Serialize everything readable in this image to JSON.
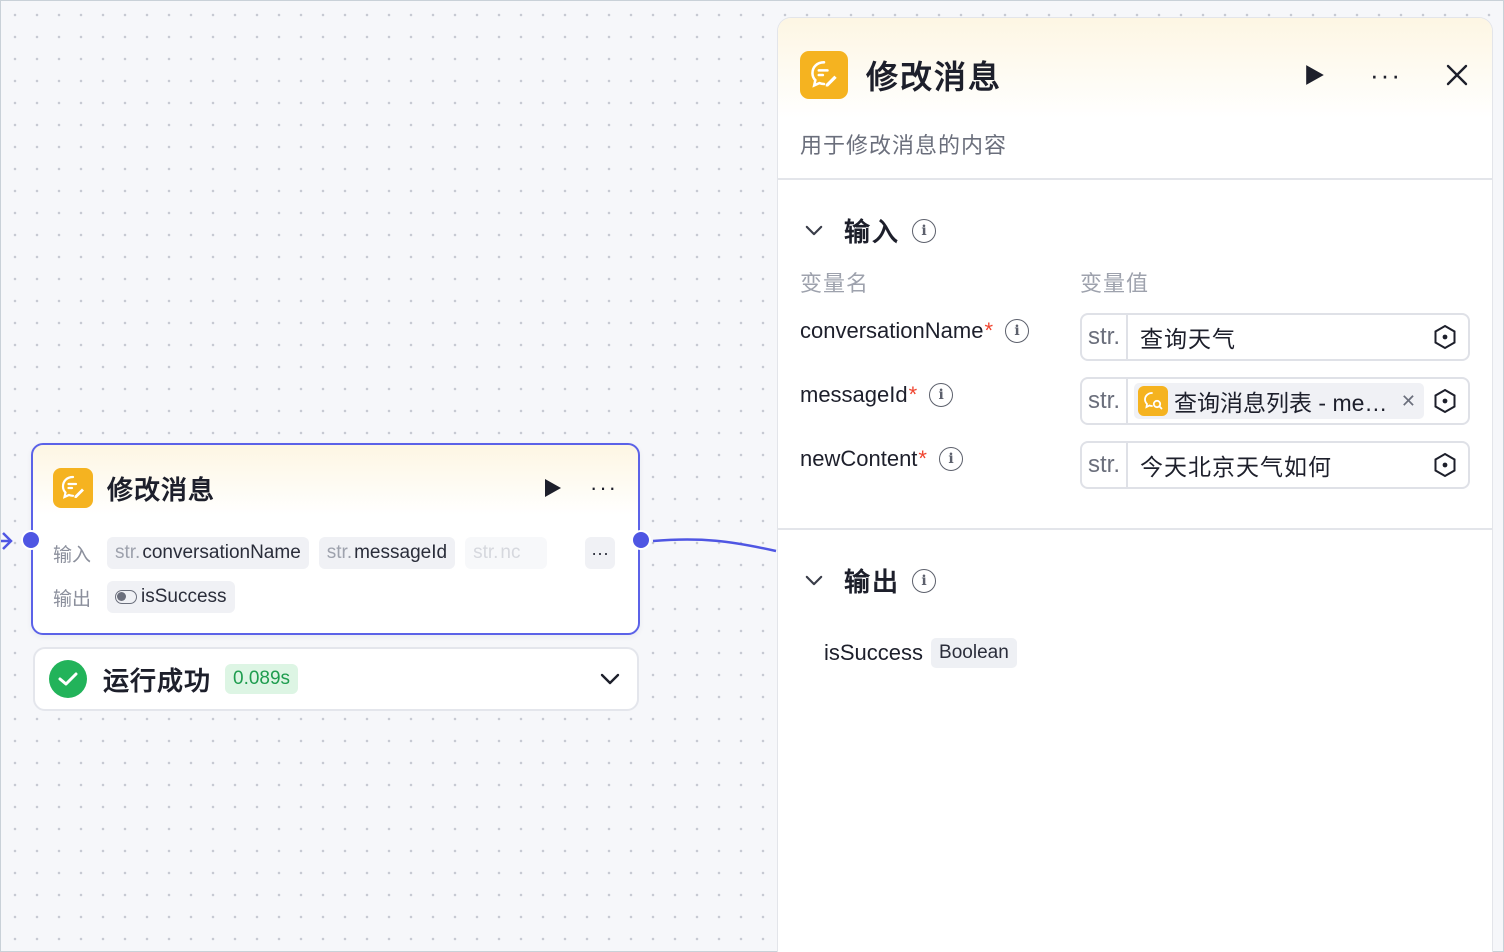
{
  "node": {
    "title": "修改消息",
    "inputs_label": "输入",
    "outputs_label": "输出",
    "input_chips": [
      {
        "type": "str.",
        "name": "conversationName"
      },
      {
        "type": "str.",
        "name": "messageId"
      },
      {
        "type": "str.",
        "name": "nc"
      }
    ],
    "more_chip": "···",
    "output_chips": [
      {
        "name": "isSuccess"
      }
    ]
  },
  "status": {
    "text": "运行成功",
    "time": "0.089s"
  },
  "panel": {
    "title": "修改消息",
    "description": "用于修改消息的内容",
    "input_section": "输入",
    "col_name": "变量名",
    "col_value": "变量值",
    "params": [
      {
        "name": "conversationName",
        "required": "*",
        "type": "str.",
        "value": "查询天气"
      },
      {
        "name": "messageId",
        "required": "*",
        "type": "str.",
        "ref": "查询消息列表 - me…"
      },
      {
        "name": "newContent",
        "required": "*",
        "type": "str.",
        "value": "今天北京天气如何"
      }
    ],
    "output_section": "输出",
    "outputs": [
      {
        "name": "isSuccess",
        "type": "Boolean"
      }
    ]
  },
  "colors": {
    "accent": "#4f56e3",
    "node_icon": "#f5b320",
    "success": "#22b35a",
    "required": "#f0442f"
  },
  "icons": [
    "message-edit-icon",
    "play-icon",
    "more-icon",
    "close-icon",
    "chevron-down-icon",
    "info-icon",
    "check-icon",
    "hexagon-variable-icon",
    "remove-icon",
    "toggle-icon",
    "search-message-icon"
  ]
}
